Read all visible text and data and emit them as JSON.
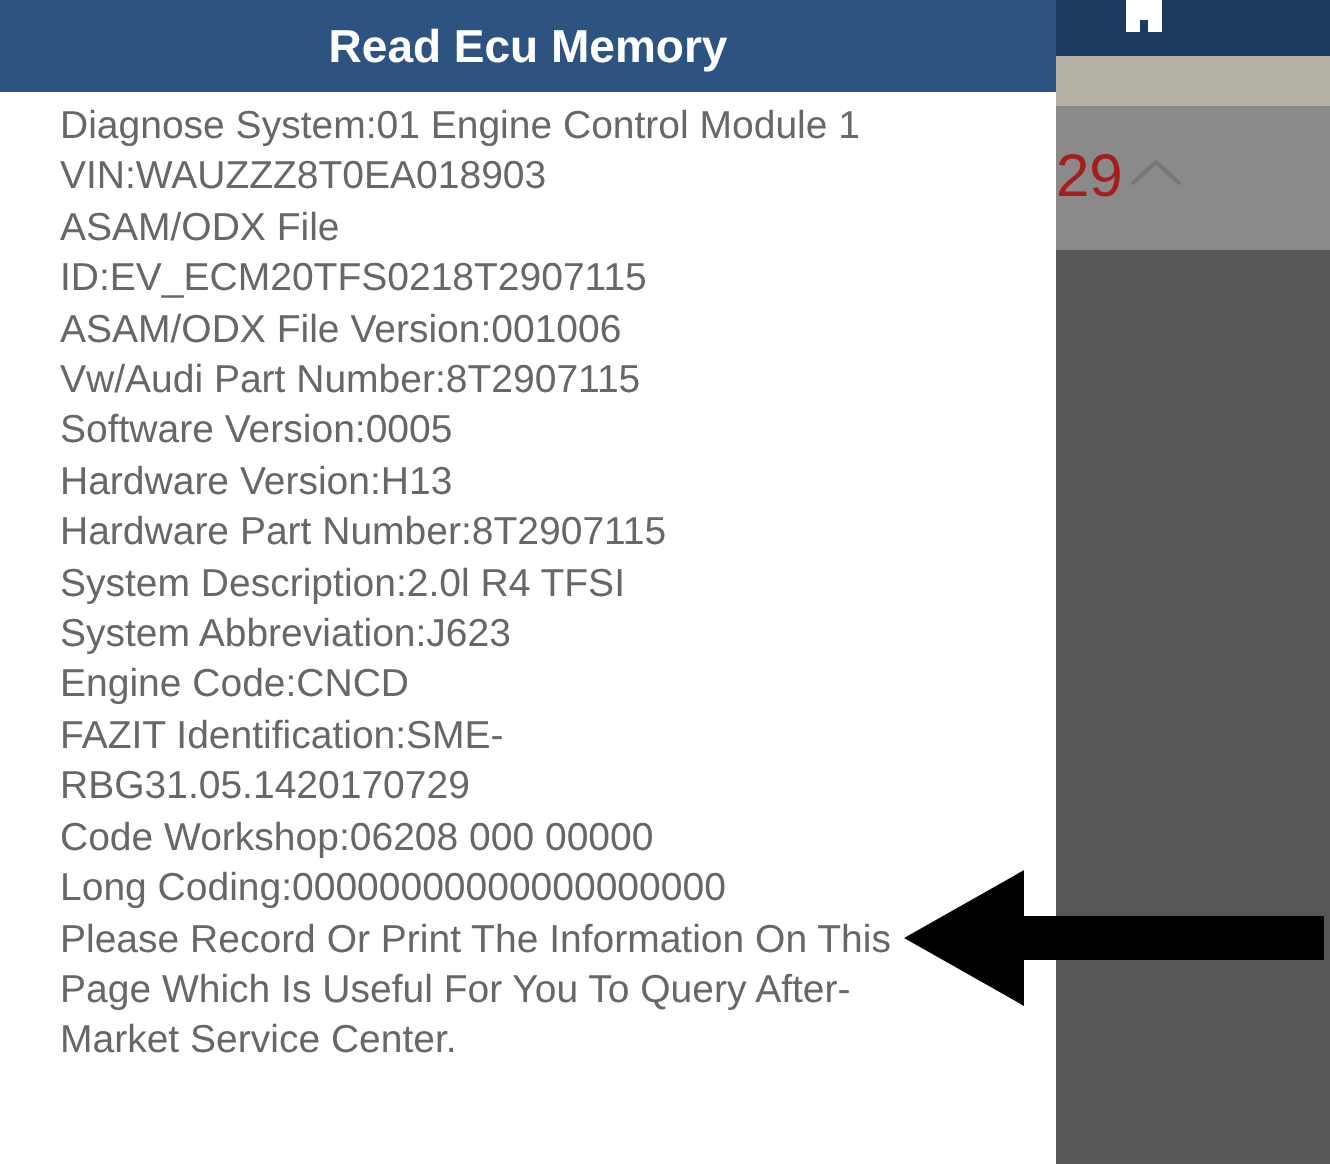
{
  "dialog": {
    "title": "Read Ecu Memory",
    "lines": [
      "Diagnose System:01 Engine Control Module 1",
      "VIN:WAUZZZ8T0EA018903",
      "ASAM/ODX File",
      "ID:EV_ECM20TFS0218T2907115",
      "ASAM/ODX File Version:001006",
      "Vw/Audi Part Number:8T2907115",
      "Software Version:0005",
      "Hardware Version:H13",
      "Hardware Part Number:8T2907115",
      "System Description:2.0l R4 TFSI",
      "System Abbreviation:J623",
      "Engine Code:CNCD",
      "FAZIT Identification:SME-",
      "RBG31.05.1420170729",
      "Code Workshop:06208  000  00000",
      "Long Coding:00000000000000000000"
    ],
    "notice": "Please Record Or Print The Information On This Page Which Is Useful For You To Query After-Market Service Center."
  },
  "background": {
    "count": "29"
  }
}
